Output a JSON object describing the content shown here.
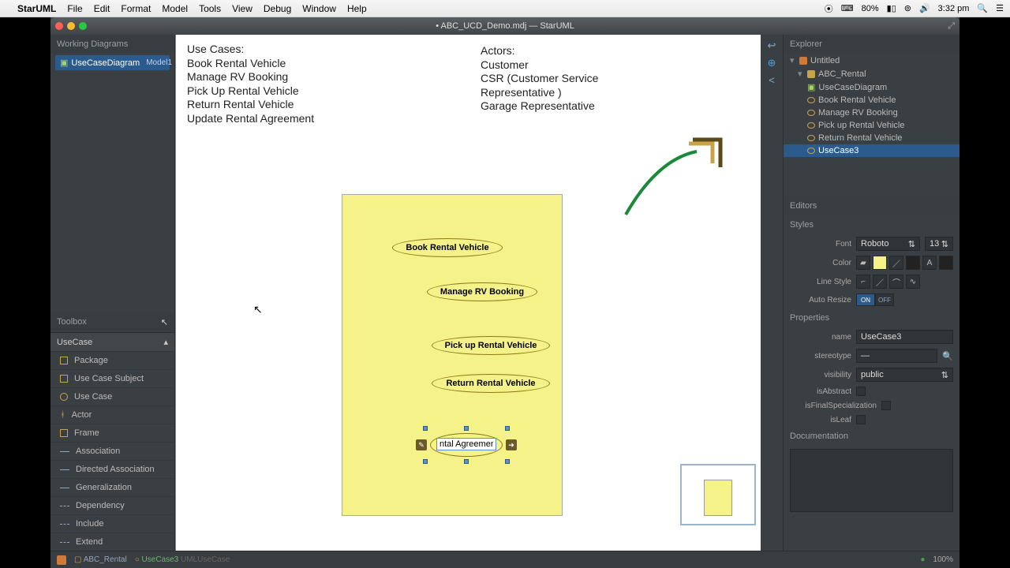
{
  "menubar": {
    "app": "StarUML",
    "items": [
      "File",
      "Edit",
      "Format",
      "Model",
      "Tools",
      "View",
      "Debug",
      "Window",
      "Help"
    ],
    "battery": "80%",
    "time": "3:32 pm"
  },
  "titlebar": "• ABC_UCD_Demo.mdj — StarUML",
  "workingDiagrams": {
    "header": "Working Diagrams",
    "item": "UseCaseDiagram",
    "itemSub": "Model1"
  },
  "toolbox": {
    "header": "Toolbox",
    "category": "UseCase",
    "items": [
      "Package",
      "Use Case Subject",
      "Use Case",
      "Actor",
      "Frame",
      "Association",
      "Directed Association",
      "Generalization",
      "Dependency",
      "Include",
      "Extend"
    ]
  },
  "canvas": {
    "useCasesHeader": "Use Cases:",
    "useCases": [
      "Book Rental Vehicle",
      "Manage RV Booking",
      "Pick Up Rental Vehicle",
      "Return Rental Vehicle",
      "Update Rental Agreement"
    ],
    "actorsHeader": "Actors:",
    "actors": [
      "Customer",
      "CSR (Customer Service",
      "Representative )",
      "Garage Representative"
    ],
    "uc1": "Book Rental Vehicle",
    "uc2": "Manage RV Booking",
    "uc3": "Pick up Rental Vehicle",
    "uc4": "Return Rental Vehicle",
    "editing": "ntal Agreement"
  },
  "explorer": {
    "header": "Explorer",
    "root": "Untitled",
    "model": "ABC_Rental",
    "diagram": "UseCaseDiagram",
    "nodes": [
      "Book Rental Vehicle",
      "Manage RV Booking",
      "Pick up Rental Vehicle",
      "Return Rental Vehicle",
      "UseCase3"
    ]
  },
  "editors": {
    "header": "Editors",
    "stylesHeader": "Styles",
    "fontLabel": "Font",
    "fontValue": "Roboto",
    "fontSize": "13",
    "colorLabel": "Color",
    "lineStyleLabel": "Line Style",
    "autoResizeLabel": "Auto Resize",
    "on": "ON",
    "off": "OFF",
    "propertiesHeader": "Properties",
    "name": {
      "label": "name",
      "value": "UseCase3"
    },
    "stereotype": {
      "label": "stereotype",
      "value": "—"
    },
    "visibility": {
      "label": "visibility",
      "value": "public"
    },
    "isAbstract": "isAbstract",
    "isFinal": "isFinalSpecialization",
    "isLeaf": "isLeaf",
    "docHeader": "Documentation"
  },
  "status": {
    "crumb1": "ABC_Rental",
    "crumb2": "UseCase3",
    "crumb2sub": "UMLUseCase",
    "zoom": "100%"
  }
}
